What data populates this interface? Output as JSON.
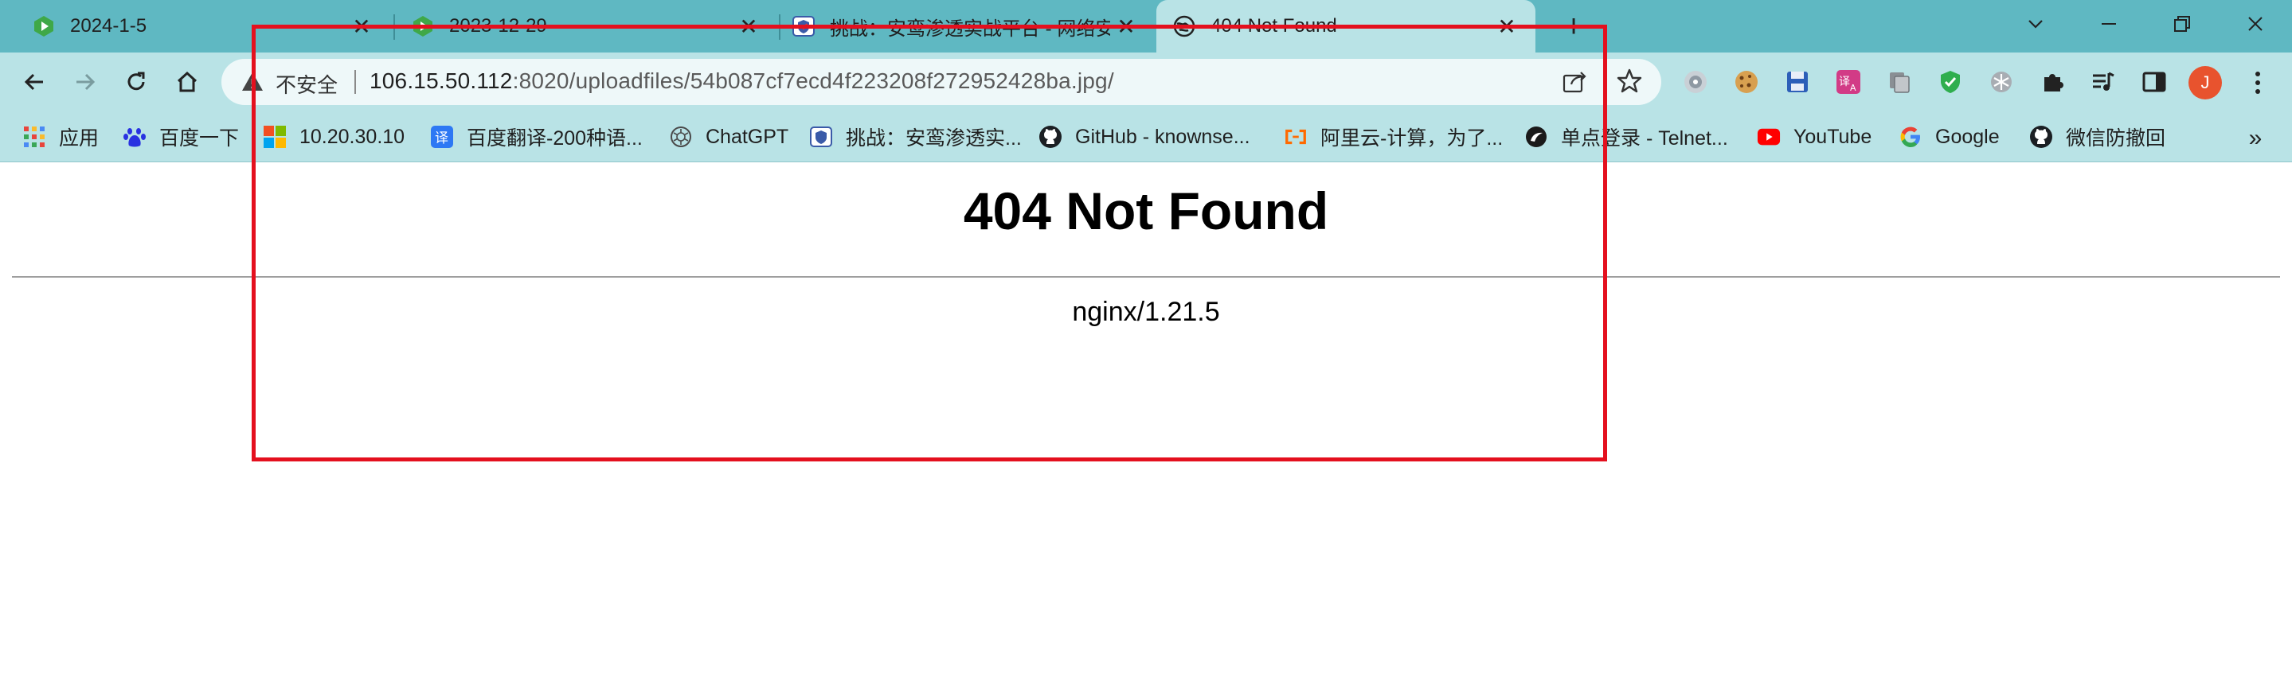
{
  "browser": {
    "tabs": [
      {
        "title": "2024-1-5",
        "favicon": "green-play-icon",
        "active": false
      },
      {
        "title": "2023-12-29",
        "favicon": "green-play-icon",
        "active": false
      },
      {
        "title": "挑战：安鸾渗透实战平台 - 网络安",
        "favicon": "shield-crest-icon",
        "active": false
      },
      {
        "title": "404 Not Found",
        "favicon": "globe-icon",
        "active": true
      }
    ],
    "tab_close_glyph": "✕",
    "new_tab_glyph": "+",
    "window_controls": [
      "chevron-down-icon",
      "minimize-icon",
      "restore-icon",
      "close-icon"
    ]
  },
  "toolbar": {
    "security_label": "不安全",
    "url_host": "106.15.50.112",
    "url_rest": ":8020/uploadfiles/54b087cf7ecd4f223208f272952428ba.jpg/",
    "avatar_letter": "J",
    "extensions": [
      "globe-ext-icon",
      "cookie-icon",
      "save-icon",
      "translate-icon",
      "copy-icon",
      "shield-check-icon",
      "snowflake-icon",
      "puzzle-icon",
      "media-queue-icon",
      "sidepanel-icon"
    ]
  },
  "bookmarks": {
    "items": [
      {
        "label": "应用",
        "icon": "apps-grid-icon"
      },
      {
        "label": "百度一下",
        "icon": "baidu-paw-icon"
      },
      {
        "label": "10.20.30.10",
        "icon": "windows-logo-icon"
      },
      {
        "label": "百度翻译-200种语...",
        "icon": "baidu-translate-icon"
      },
      {
        "label": "ChatGPT",
        "icon": "openai-icon"
      },
      {
        "label": "挑战：安鸾渗透实...",
        "icon": "shield-crest-icon"
      },
      {
        "label": "GitHub - knownse...",
        "icon": "github-icon"
      },
      {
        "label": "阿里云-计算，为了...",
        "icon": "aliyun-icon"
      },
      {
        "label": "单点登录 - Telnet...",
        "icon": "telnet-icon"
      },
      {
        "label": "YouTube",
        "icon": "youtube-icon"
      },
      {
        "label": "Google",
        "icon": "google-icon"
      },
      {
        "label": "微信防撤回",
        "icon": "github-icon"
      }
    ],
    "overflow_glyph": "»"
  },
  "page": {
    "heading": "404 Not Found",
    "server": "nginx/1.21.5"
  },
  "colors": {
    "tabstrip": "#5fb8c2",
    "toolbar": "#b9e3e6",
    "highlight": "#e4101e"
  }
}
